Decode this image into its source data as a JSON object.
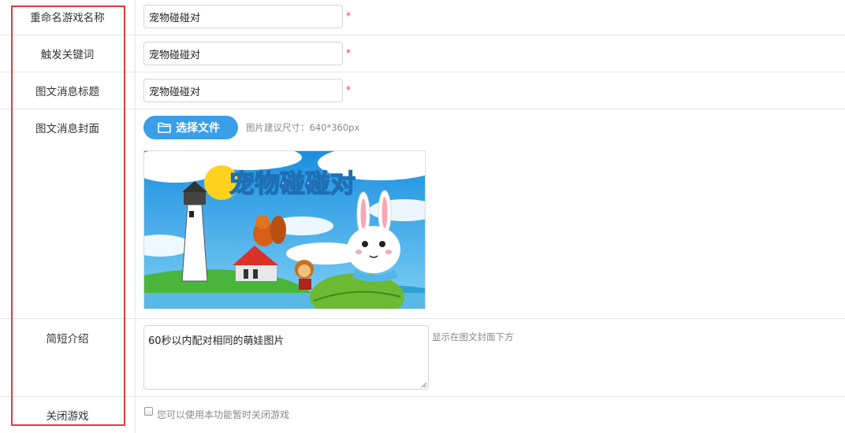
{
  "form": {
    "rename": {
      "label": "重命名游戏名称",
      "value": "宠物碰碰对",
      "required_mark": "*"
    },
    "keyword": {
      "label": "触发关键词",
      "value": "宠物碰碰对",
      "required_mark": "*"
    },
    "news_title": {
      "label": "图文消息标题",
      "value": "宠物碰碰对",
      "required_mark": "*"
    },
    "cover": {
      "label": "图文消息封面",
      "button_label": "选择文件",
      "button_icon": "folder-icon",
      "size_hint": "图片建议尺寸：640*360px",
      "image_title": "宠物碰碰对"
    },
    "intro": {
      "label": "简短介绍",
      "value": "60秒以内配对相同的萌娃图片",
      "hint": "显示在图文封面下方"
    },
    "close_game": {
      "label": "关闭游戏",
      "checkbox_label": "您可以使用本功能暂时关闭游戏",
      "checked": false
    }
  },
  "colors": {
    "accent": "#3a9ee8",
    "required": "#e4393c",
    "highlight_box": "#e03c3c"
  }
}
